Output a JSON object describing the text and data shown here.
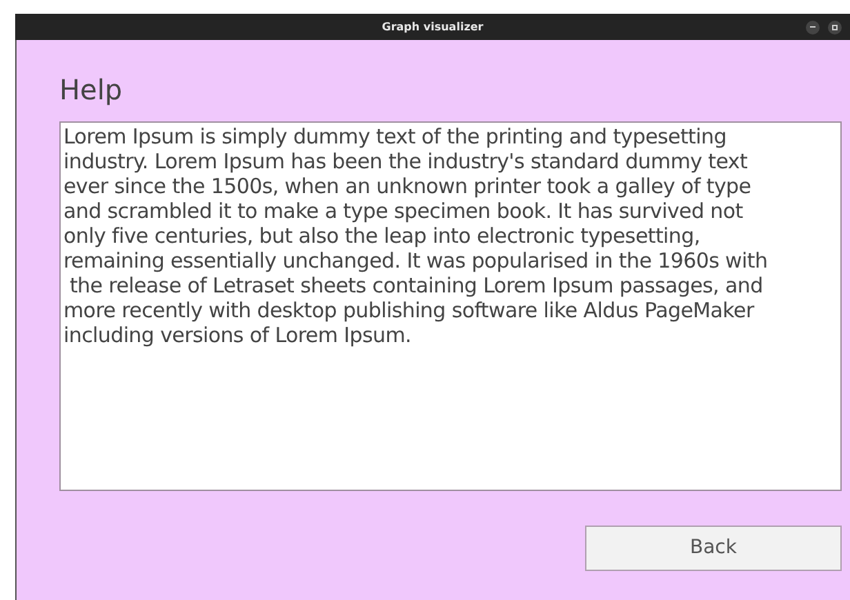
{
  "window": {
    "title": "Graph visualizer"
  },
  "heading": "Help",
  "help_text": "Lorem Ipsum is simply dummy text of the printing and typesetting\nindustry. Lorem Ipsum has been the industry's standard dummy text\never since the 1500s, when an unknown printer took a galley of type\nand scrambled it to make a type specimen book. It has survived not\nonly five centuries, but also the leap into electronic typesetting,\nremaining essentially unchanged. It was popularised in the 1960s with\n the release of Letraset sheets containing Lorem Ipsum passages, and\nmore recently with desktop publishing software like Aldus PageMaker\nincluding versions of Lorem Ipsum.",
  "buttons": [
    "Back"
  ]
}
